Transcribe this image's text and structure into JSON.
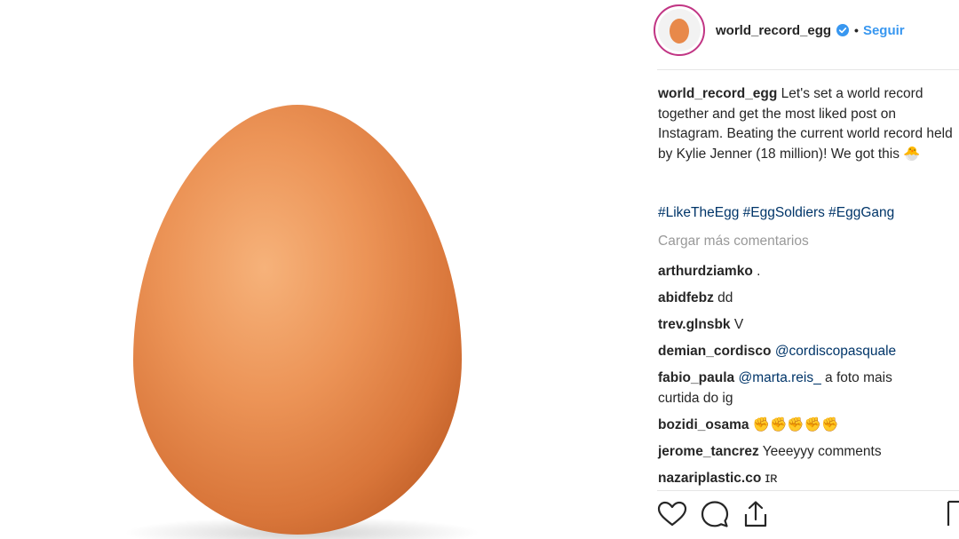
{
  "post": {
    "username": "world_record_egg",
    "follow_label": "Seguir",
    "separator": "•"
  },
  "caption": {
    "username": "world_record_egg",
    "text": " Let's set a world record together and get the most liked post on Instagram. Beating the current world record held by Kylie Jenner (18 million)! We got this",
    "emoji": "🐣"
  },
  "hashtags": [
    "#LikeTheEgg",
    "#EggSoldiers",
    "#EggGang"
  ],
  "load_more": "Cargar más comentarios",
  "comments": [
    {
      "user": "arthurdziamko",
      "text": " ."
    },
    {
      "user": "abidfebz",
      "text": " dd"
    },
    {
      "user": "trev.glnsbk",
      "text": " V"
    },
    {
      "user": "demian_cordisco",
      "mention": "@cordiscopasquale",
      "text": ""
    },
    {
      "user": "fabio_paula",
      "mention": "@marta.reis_",
      "text": " a foto mais curtida do ig"
    },
    {
      "user": "bozidi_osama",
      "text": " ✊✊✊✊✊"
    },
    {
      "user": "jerome_tancrez",
      "text": " Yeeeyyy comments"
    },
    {
      "user": "nazariplastic.co",
      "text": " ɪʀ"
    }
  ],
  "icons": {
    "like": "heart-icon",
    "comment": "comment-icon",
    "share": "share-icon",
    "save": "bookmark-icon",
    "verified": "verified-badge-icon"
  },
  "colors": {
    "link": "#3897f0",
    "hashtag": "#003569",
    "muted": "#999999",
    "egg": "#e8894a"
  }
}
